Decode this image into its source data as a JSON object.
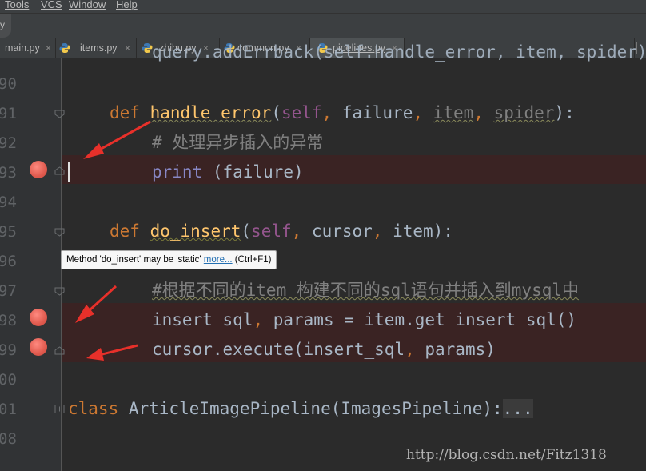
{
  "menu": {
    "items": [
      "Tools",
      "VCS",
      "Window",
      "Help"
    ]
  },
  "breadcrumb": {
    "label": "y"
  },
  "tabs": [
    {
      "label": "main.py",
      "close": "×"
    },
    {
      "label": "items.py",
      "close": "×"
    },
    {
      "label": "zhihu.py",
      "close": "×"
    },
    {
      "label": "common.py",
      "close": "×"
    },
    {
      "label": "pipelines.py",
      "close": "×",
      "active": true
    }
  ],
  "line_numbers": [
    "90",
    "91",
    "92",
    "93",
    "94",
    "95",
    "96",
    "97",
    "98",
    "99",
    "00",
    "01",
    "08"
  ],
  "code": {
    "l89": {
      "text": "query.addErrback(self.handle_error, item, spider)"
    },
    "l91": {
      "kw": "def",
      "fn": "handle_error",
      "open": "(",
      "self": "self",
      "comma1": ",",
      "p1": " failure",
      "comma2": ",",
      "p2": "item",
      "comma3": ",",
      "p3": "spider",
      "close": "):"
    },
    "l92": {
      "comment": "# 处理异步插入的异常"
    },
    "l93": {
      "fn": "print",
      "rest": " (failure)"
    },
    "l95": {
      "kw": "def",
      "fn": "do_insert",
      "open": "(",
      "self": "self",
      "comma1": ",",
      "p1": " cursor",
      "comma2": ",",
      "p2": " item",
      "close": "):"
    },
    "l97": {
      "comment": "#根据不同的item 构建不同的sql语句并插入到mysql中"
    },
    "l98": {
      "text": "insert_sql",
      "comma": ",",
      "rest": " params = item.get_insert_sql()"
    },
    "l99": {
      "text": "cursor.execute(insert_sql",
      "comma": ",",
      "rest": " params)"
    },
    "l01": {
      "kw": "class",
      "rest": " ArticleImagePipeline(ImagesPipeline):",
      "ellipsis": "..."
    }
  },
  "tooltip": {
    "text": "Method 'do_insert' may be 'static'",
    "link": "more...",
    "shortcut": "(Ctrl+F1)"
  },
  "watermark": "http://blog.csdn.net/Fitz1318",
  "colors": {
    "background": "#2b2b2b",
    "gutter": "#313335",
    "keyword": "#cc7832",
    "function": "#ffc66d",
    "self": "#94558d",
    "comment": "#808080",
    "breakpoint": "#e05a4e",
    "breakpoint_row": "#3a2323",
    "arrow": "#e8302a"
  }
}
